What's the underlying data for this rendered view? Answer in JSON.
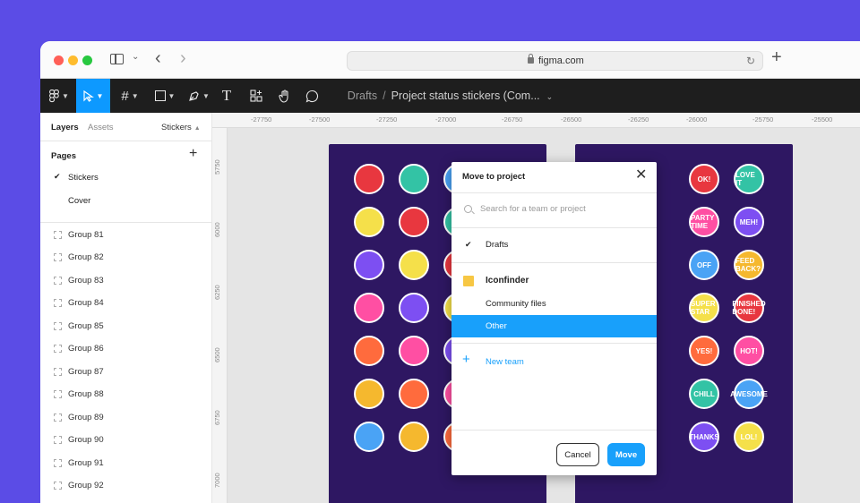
{
  "browser": {
    "url": "figma.com"
  },
  "toolbar": {
    "breadcrumb_parent": "Drafts",
    "breadcrumb_sep": "/",
    "file_title": "Project status stickers (Com..."
  },
  "left_panel": {
    "tabs": {
      "layers": "Layers",
      "assets": "Assets",
      "page_selector": "Stickers"
    },
    "pages_heading": "Pages",
    "pages": [
      {
        "label": "Stickers",
        "current": true
      },
      {
        "label": "Cover",
        "current": false
      }
    ],
    "layers": [
      "Group 81",
      "Group 82",
      "Group 83",
      "Group 84",
      "Group 85",
      "Group 86",
      "Group 87",
      "Group 88",
      "Group 89",
      "Group 90",
      "Group 91",
      "Group 92"
    ]
  },
  "rulers": {
    "top": [
      "-27750",
      "-27500",
      "-27250",
      "-27000",
      "-26750",
      "-26500",
      "-26250",
      "-26000",
      "-25750",
      "-25500"
    ],
    "left": [
      "5750",
      "6000",
      "6250",
      "6500",
      "6750",
      "7000"
    ]
  },
  "stickers": {
    "left_board": [
      "",
      "",
      "",
      "",
      "",
      "",
      "",
      "",
      "",
      "",
      "",
      "",
      "",
      "",
      "",
      "",
      "",
      "",
      "",
      "",
      "",
      "",
      "",
      "",
      "",
      "",
      "",
      ""
    ],
    "right_board": [
      "OK!",
      "LOVE IT",
      "PARTY TIME",
      "MEH!",
      "OFF",
      "FEED BACK?",
      "SUPER STAR",
      "FINISHED DONE!",
      "YES!",
      "HOT!",
      "CHILL",
      "AWESOME",
      "THANKS",
      "LOL!"
    ],
    "colors": [
      "#e8373f",
      "#f5b82e",
      "#7d4ff2",
      "#33c3a5",
      "#ff6b3d",
      "#f5e04a",
      "#4aa3f5",
      "#ff4fa3"
    ]
  },
  "modal": {
    "title": "Move to project",
    "search_placeholder": "Search for a team or project",
    "drafts_label": "Drafts",
    "team_name": "Iconfinder",
    "team_color": "#f7c744",
    "projects": [
      {
        "label": "Community files",
        "selected": false
      },
      {
        "label": "Other",
        "selected": true
      }
    ],
    "new_team_label": "New team",
    "cancel_label": "Cancel",
    "move_label": "Move"
  }
}
